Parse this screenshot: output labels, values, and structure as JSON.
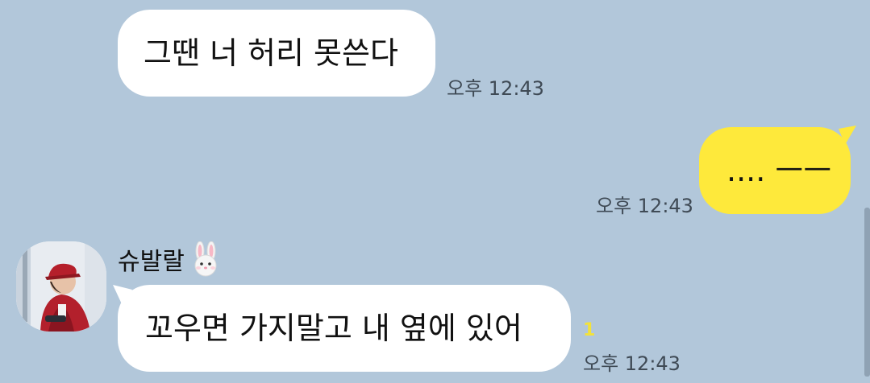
{
  "messages": [
    {
      "direction": "incoming",
      "text": "그땐 너 허리 못쓴다",
      "time": "오후 12:43"
    },
    {
      "direction": "outgoing",
      "text": ".... ㅡㅡ",
      "time": "오후 12:43"
    },
    {
      "direction": "incoming",
      "sender": "슈발랄",
      "sender_emoji": "🐰",
      "text": "꼬우면 가지말고 내 옆에 있어",
      "unread": "1",
      "time": "오후 12:43"
    }
  ],
  "colors": {
    "background": "#b2c7da",
    "incoming_bubble": "#ffffff",
    "outgoing_bubble": "#fee93b",
    "unread_count": "#f3e23a"
  },
  "icons": {
    "avatar": "profile-photo",
    "sender_emoji": "rabbit-face-icon"
  }
}
